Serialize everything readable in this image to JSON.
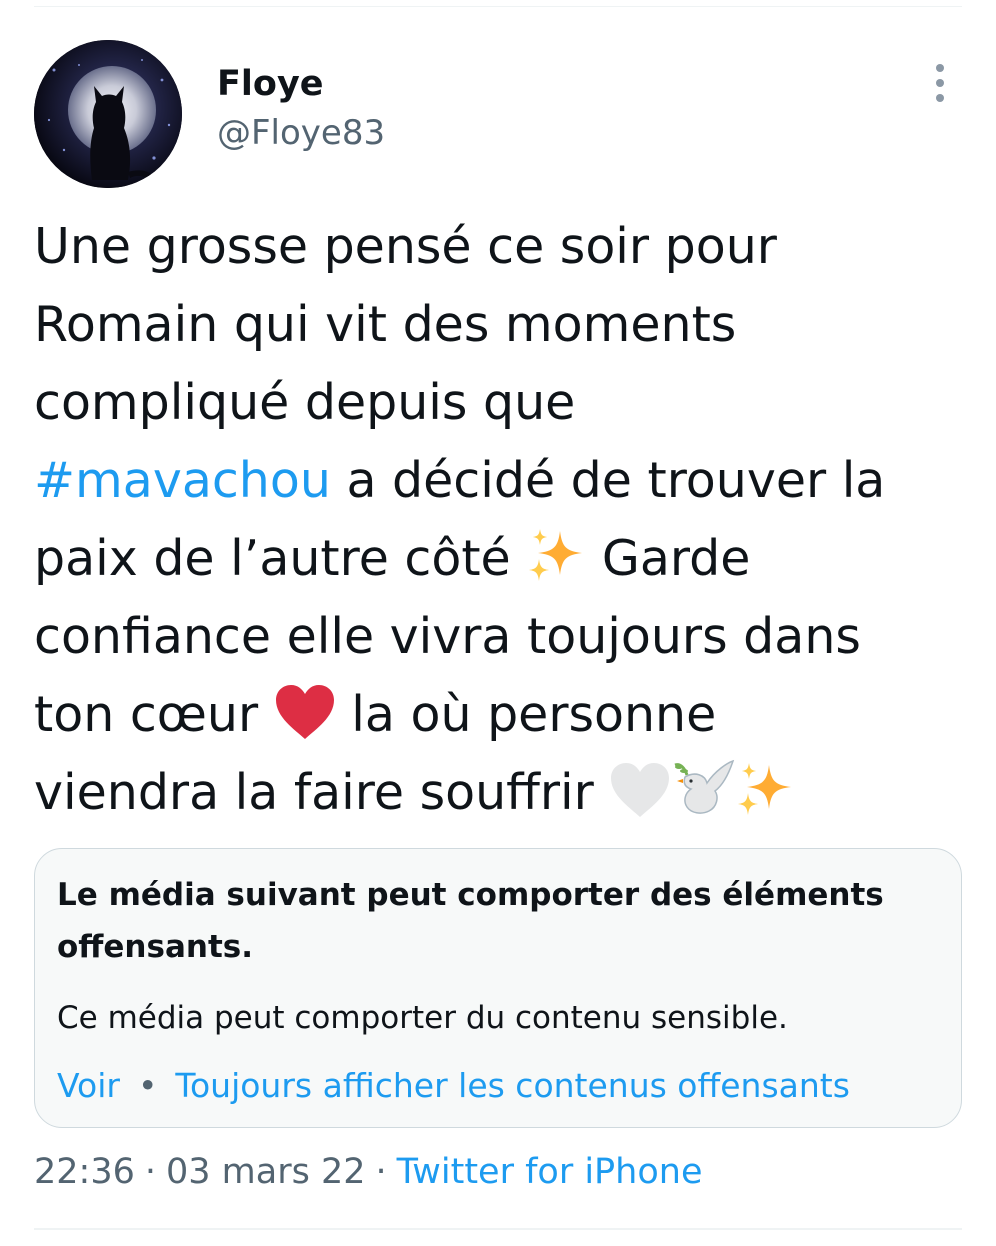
{
  "tweet": {
    "author": {
      "display_name": "Floye",
      "handle": "@Floye83"
    },
    "text_lines": {
      "l1": "Une grosse pensé ce soir pour",
      "l2": "Romain qui vit des moments",
      "l3": "compliqué depuis que",
      "l4_hashtag": "#mavachou",
      "l4_rest": " a décidé de trouver la",
      "l5_a": "paix de l’autre côté ",
      "l5_b": " Garde",
      "l6": "confiance elle vivra toujours dans",
      "l7_a": "ton cœur ",
      "l7_b": " la où personne",
      "l8": "viendra la faire souffrir "
    },
    "emoji_icons": [
      "sparkles-icon",
      "red-heart-icon",
      "white-heart-icon",
      "dove-icon",
      "sparkles-icon"
    ],
    "sensitive_media": {
      "title": "Le média suivant peut comporter des éléments offensants.",
      "description": "Ce média peut comporter du contenu sensible.",
      "view_label": "Voir",
      "separator": "•",
      "always_show_label": "Toujours afficher les contenus offensants"
    },
    "meta": {
      "time": "22:36",
      "separator": "·",
      "date": "03 mars 22",
      "source": "Twitter for iPhone"
    }
  },
  "colors": {
    "link": "#1d9bf0",
    "secondary_text": "#536471",
    "primary_text": "#0f1419",
    "card_background": "#f7f9f9",
    "heart_red": "#dd2e44",
    "sparkle_yellow": "#ffac33"
  }
}
